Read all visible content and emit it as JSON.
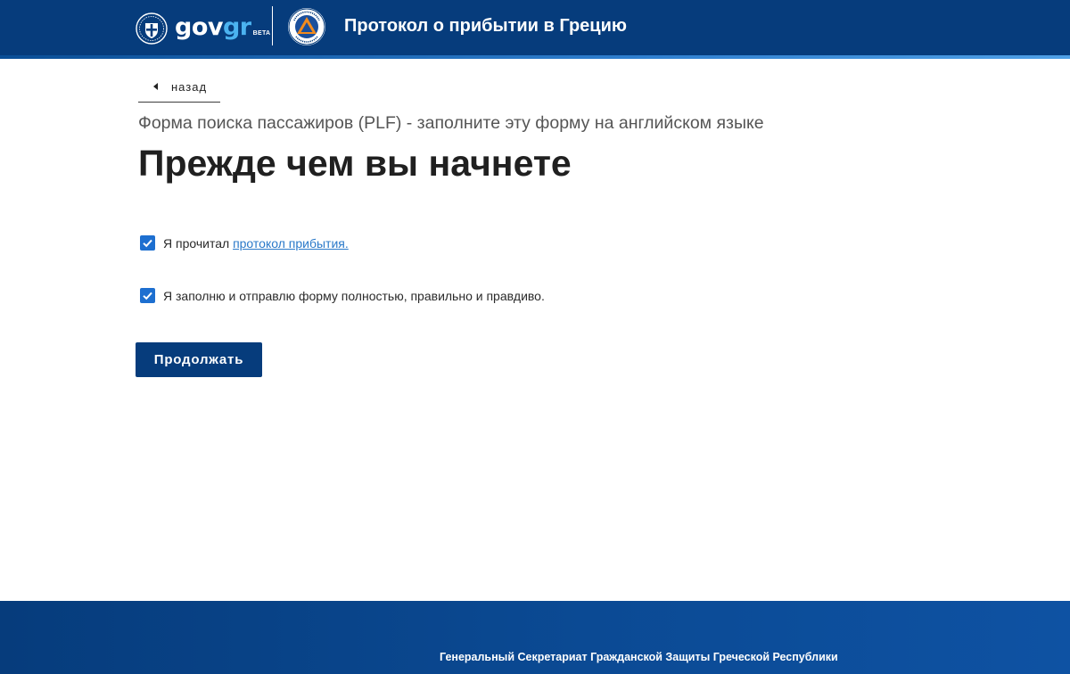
{
  "header": {
    "logo_gov": "gov",
    "logo_gr": "gr",
    "logo_beta": "BETA",
    "emblem_icon": "greek-emblem-icon",
    "civil_protection_icon": "civil-protection-logo-icon",
    "title": "Протокол о прибытии в Грецию",
    "colors": {
      "header_bg": "#063c7c",
      "accent": "#4bb3f0"
    }
  },
  "back": {
    "label": "назад",
    "icon": "caret-left-icon"
  },
  "subtitle": "Форма поиска пассажиров (PLF) - заполните эту форму на английском языке",
  "page_title": "Прежде чем вы начнете",
  "checkboxes": [
    {
      "checked": true,
      "text_before": "Я прочитал ",
      "link_text": "протокол прибытия."
    },
    {
      "checked": true,
      "text_before": "Я заполню и отправлю форму полностью, правильно и правдиво."
    }
  ],
  "continue_button": {
    "label": "Продолжать",
    "color": "#063c7c"
  },
  "footer": {
    "text": "Генеральный Секретариат Гражданской Защиты Греческой Республики"
  }
}
